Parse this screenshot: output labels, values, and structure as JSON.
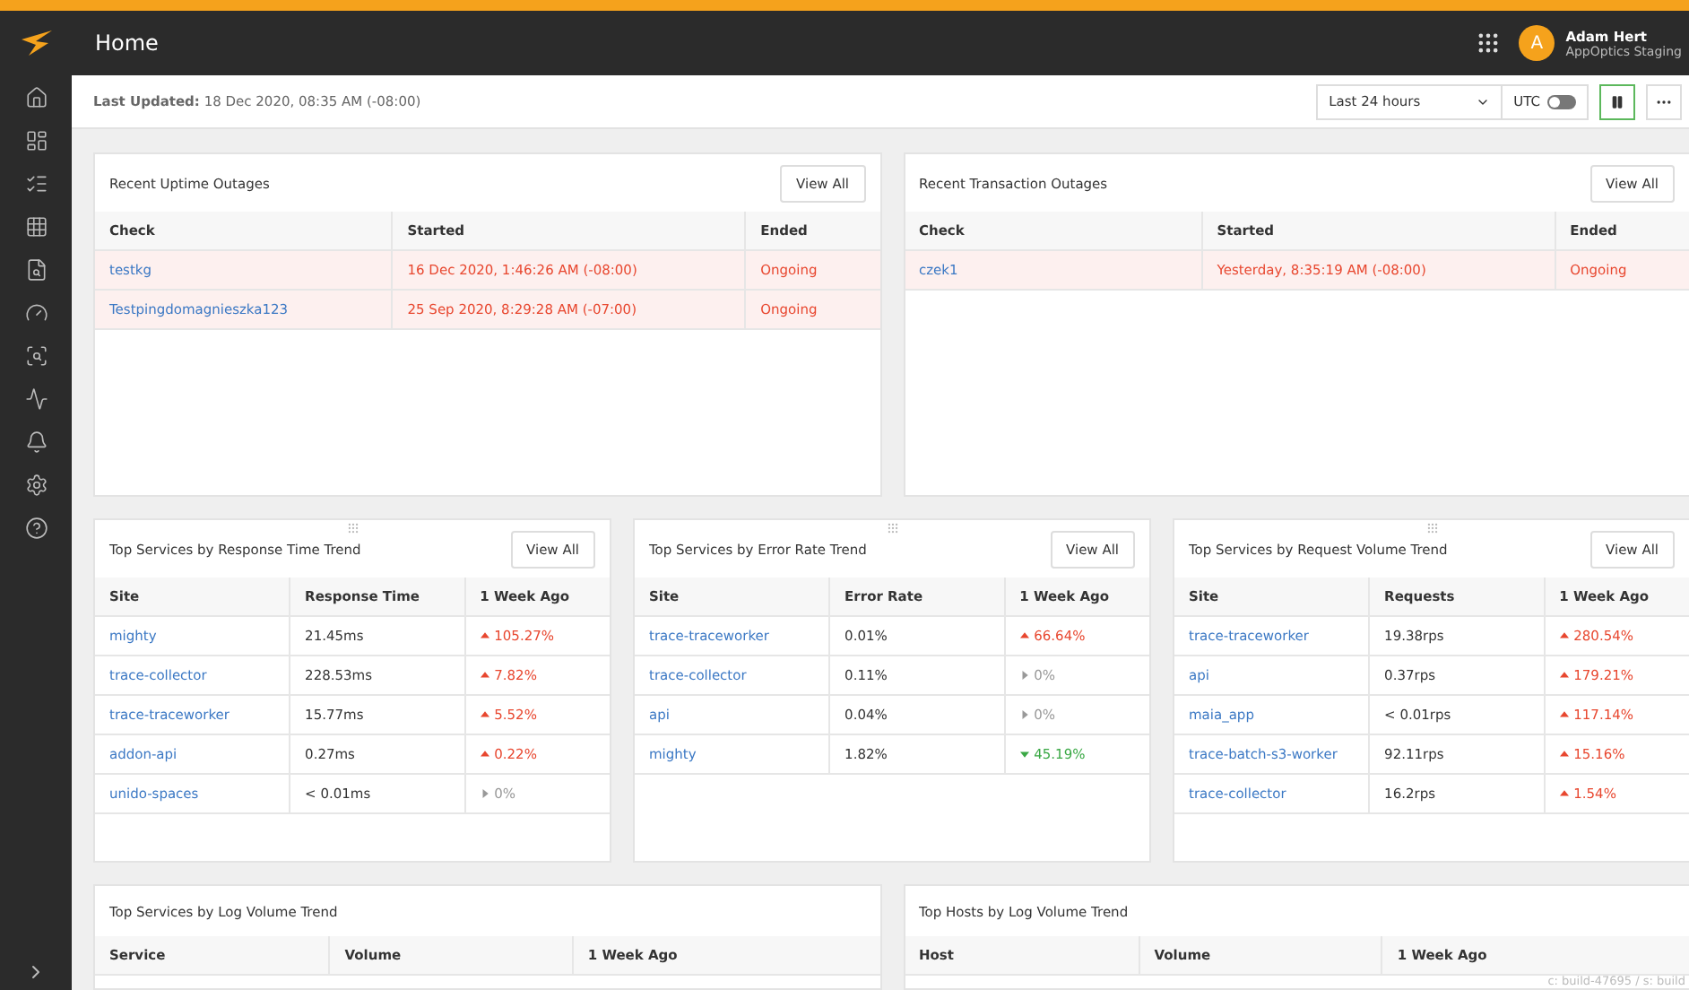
{
  "header": {
    "title": "Home",
    "user": {
      "initial": "A",
      "name": "Adam Hert",
      "org": "AppOptics Staging"
    }
  },
  "toolbar": {
    "last_updated_label": "Last Updated:",
    "last_updated": "18 Dec 2020, 08:35 AM (-08:00)",
    "range": "Last 24 hours",
    "utc_label": "UTC",
    "utc_on": false,
    "paused": false
  },
  "cards": [
    {
      "kind": "outages",
      "title": "Recent Uptime Outages",
      "button": "View All",
      "columns": [
        "Check",
        "Started",
        "Ended"
      ],
      "rows": [
        {
          "cells": [
            "testkg",
            "16 Dec 2020, 1:46:26 AM (-08:00)",
            "Ongoing"
          ]
        },
        {
          "cells": [
            "Testpingdomagnieszka123",
            "25 Sep 2020, 8:29:28 AM (-07:00)",
            "Ongoing"
          ]
        }
      ]
    },
    {
      "kind": "outages",
      "title": "Recent Transaction Outages",
      "button": "View All",
      "columns": [
        "Check",
        "Started",
        "Ended"
      ],
      "rows": [
        {
          "cells": [
            "czek1",
            "Yesterday, 8:35:19 AM (-08:00)",
            "Ongoing"
          ]
        }
      ]
    },
    {
      "kind": "trend",
      "title": "Top Services by Response Time Trend",
      "button": "View All",
      "columns": [
        "Site",
        "Response Time",
        "1 Week Ago"
      ],
      "rows": [
        {
          "cells": [
            "mighty",
            "21.45ms",
            "105.27%"
          ],
          "kind": "up"
        },
        {
          "cells": [
            "trace-collector",
            "228.53ms",
            "7.82%"
          ],
          "kind": "up"
        },
        {
          "cells": [
            "trace-traceworker",
            "15.77ms",
            "5.52%"
          ],
          "kind": "up"
        },
        {
          "cells": [
            "addon-api",
            "0.27ms",
            "0.22%"
          ],
          "kind": "up"
        },
        {
          "cells": [
            "unido-spaces",
            "< 0.01ms",
            "0%"
          ],
          "kind": "flat"
        }
      ]
    },
    {
      "kind": "trend",
      "title": "Top Services by Error Rate Trend",
      "button": "View All",
      "columns": [
        "Site",
        "Error Rate",
        "1 Week Ago"
      ],
      "rows": [
        {
          "cells": [
            "trace-traceworker",
            "0.01%",
            "66.64%"
          ],
          "kind": "up"
        },
        {
          "cells": [
            "trace-collector",
            "0.11%",
            "0%"
          ],
          "kind": "flat"
        },
        {
          "cells": [
            "api",
            "0.04%",
            "0%"
          ],
          "kind": "flat"
        },
        {
          "cells": [
            "mighty",
            "1.82%",
            "45.19%"
          ],
          "kind": "down"
        }
      ]
    },
    {
      "kind": "trend",
      "title": "Top Services by Request Volume Trend",
      "button": "View All",
      "columns": [
        "Site",
        "Requests",
        "1 Week Ago"
      ],
      "rows": [
        {
          "cells": [
            "trace-traceworker",
            "19.38rps",
            "280.54%"
          ],
          "kind": "up"
        },
        {
          "cells": [
            "api",
            "0.37rps",
            "179.21%"
          ],
          "kind": "up"
        },
        {
          "cells": [
            "maia_app",
            "< 0.01rps",
            "117.14%"
          ],
          "kind": "up"
        },
        {
          "cells": [
            "trace-batch-s3-worker",
            "92.11rps",
            "15.16%"
          ],
          "kind": "up"
        },
        {
          "cells": [
            "trace-collector",
            "16.2rps",
            "1.54%"
          ],
          "kind": "up"
        }
      ]
    },
    {
      "kind": "log",
      "title": "Top Services by Log Volume Trend",
      "columns": [
        "Service",
        "Volume",
        "1 Week Ago"
      ]
    },
    {
      "kind": "log",
      "title": "Top Hosts by Log Volume Trend",
      "columns": [
        "Host",
        "Volume",
        "1 Week Ago"
      ]
    }
  ],
  "build_info": "c: build-47695 / s: build"
}
